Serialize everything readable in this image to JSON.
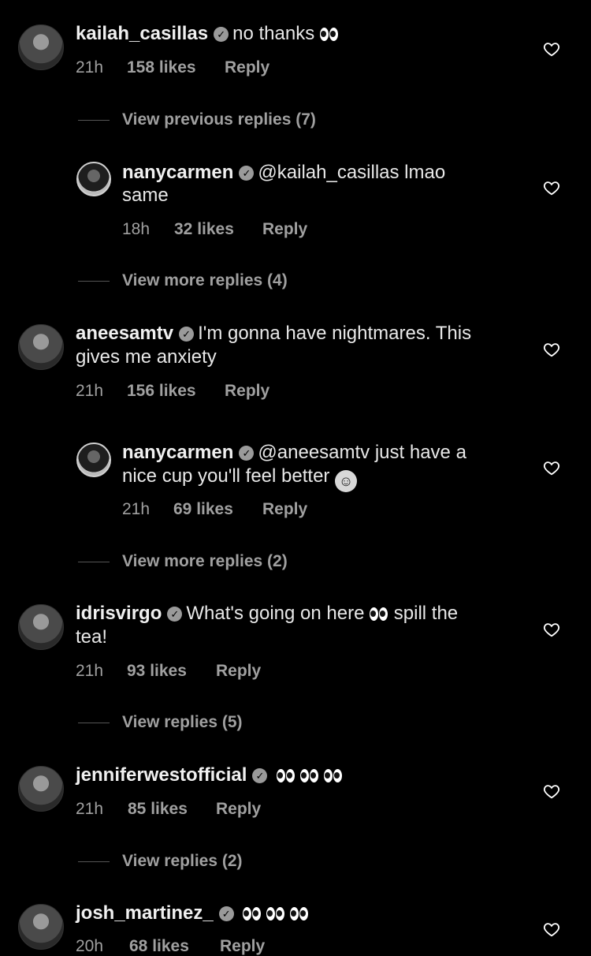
{
  "comments": [
    {
      "username": "kailah_casillas",
      "text_before": "no thanks",
      "eyes": 1,
      "text_after": "",
      "text_line2": "",
      "time": "21h",
      "likes": "158 likes",
      "reply": "Reply",
      "view_more": "View previous replies (7)"
    },
    {
      "username": "nanycarmen",
      "text_before": "@kailah_casillas lmao",
      "text_line2": "same",
      "time": "18h",
      "likes": "32 likes",
      "reply": "Reply",
      "view_more": "View more replies (4)"
    },
    {
      "username": "aneesamtv",
      "text_before": "I'm gonna have nightmares. This",
      "text_line2": "gives me anxiety",
      "time": "21h",
      "likes": "156 likes",
      "reply": "Reply"
    },
    {
      "username": "nanycarmen",
      "text_before": "@aneesamtv just have a",
      "text_line2": "nice cup you'll feel better",
      "time": "21h",
      "likes": "69 likes",
      "reply": "Reply",
      "view_more": "View more replies (2)"
    },
    {
      "username": "idrisvirgo",
      "text_before": "What's going on here",
      "text_after": "spill the",
      "text_line2": "tea!",
      "time": "21h",
      "likes": "93 likes",
      "reply": "Reply",
      "view_more": "View replies (5)"
    },
    {
      "username": "jenniferwestofficial",
      "time": "21h",
      "likes": "85 likes",
      "reply": "Reply",
      "view_more": "View replies (2)"
    },
    {
      "username": "josh_martinez_",
      "time": "20h",
      "likes": "68 likes",
      "reply": "Reply"
    }
  ],
  "icons": {
    "verified": "verified-badge-icon",
    "like": "heart-outline-icon",
    "eyes": "eyes-emoji",
    "woozy": "woozy-face-emoji"
  }
}
